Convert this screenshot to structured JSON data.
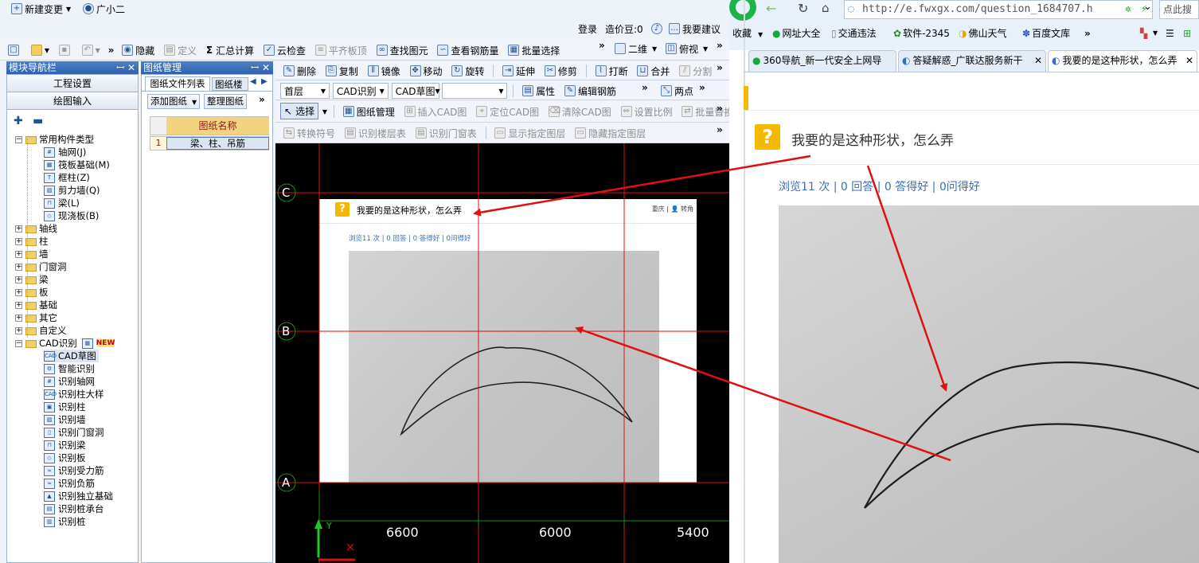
{
  "cad": {
    "menu": {
      "new_change": "新建变更",
      "user": "广小二"
    },
    "login_bar": {
      "login": "登录",
      "price_beans": "造价豆:0",
      "suggest": "我要建议"
    },
    "toolbar1": {
      "hide": "隐藏",
      "define": "定义",
      "sum_calc": "汇总计算",
      "cloud_check": "云检查",
      "flush_top": "平齐板顶",
      "find_element": "查找图元",
      "view_rebar": "查看钢筋量",
      "batch_select": "批量选择",
      "view_mode": "二维",
      "view_dir": "俯视"
    },
    "nav_panel": {
      "title": "模块导航栏",
      "project_settings": "工程设置",
      "drawing_input": "绘图输入"
    },
    "tree": {
      "common": "常用构件类型",
      "common_items": [
        "轴网(J)",
        "筏板基础(M)",
        "框柱(Z)",
        "剪力墙(Q)",
        "梁(L)",
        "现浇板(B)"
      ],
      "groups": [
        "轴线",
        "柱",
        "墙",
        "门窗洞",
        "梁",
        "板",
        "基础",
        "其它",
        "自定义"
      ],
      "cad_group": "CAD识别",
      "new_badge": "NEW",
      "cad_items": [
        "CAD草图",
        "智能识别",
        "识别轴网",
        "识别柱大样",
        "识别柱",
        "识别墙",
        "识别门窗洞",
        "识别梁",
        "识别板",
        "识别受力筋",
        "识别负筋",
        "识别独立基础",
        "识别桩承台",
        "识别桩"
      ]
    },
    "drawing_panel": {
      "title": "图纸管理",
      "tab1": "图纸文件列表",
      "tab2": "图纸楼",
      "add_drawing": "添加图纸",
      "organize": "整理图纸",
      "col_header": "图纸名称",
      "row_num": "1",
      "row_name": "梁、柱、吊筋"
    },
    "toolbar2": {
      "delete": "删除",
      "copy": "复制",
      "mirror": "镜像",
      "move": "移动",
      "rotate": "旋转",
      "extend": "延伸",
      "trim": "修剪",
      "break": "打断",
      "merge": "合并",
      "split": "分割"
    },
    "toolbar3": {
      "floor": "首层",
      "cad_recog": "CAD识别",
      "cad_sketch": "CAD草图",
      "property": "属性",
      "edit_rebar": "编辑钢筋",
      "two_point": "两点"
    },
    "toolbar4": {
      "select": "选择",
      "drawing_mgmt": "图纸管理",
      "insert_cad": "插入CAD图",
      "locate_cad": "定位CAD图",
      "clear_cad": "清除CAD图",
      "set_scale": "设置比例",
      "batch_replace": "批量替换"
    },
    "toolbar5": {
      "convert_symbol": "转换符号",
      "recog_floor_table": "识别楼层表",
      "recog_door_table": "识别门窗表",
      "show_layer": "显示指定图层",
      "hide_layer": "隐藏指定图层"
    },
    "canvas": {
      "axis_labels": [
        "C",
        "B",
        "A"
      ],
      "dimensions": [
        "6600",
        "6000",
        "5400"
      ],
      "y_label": "Y",
      "x_label": "X",
      "embedded_question": "我要的是这种形状，怎么弄",
      "embedded_links": "重庆 | 👤 转角",
      "embedded_stats": "浏览11 次 | 0 回答 | 0 答得好 | 0问得好"
    }
  },
  "browser": {
    "search_hint": "点此搜",
    "address": "http://e.fwxgx.com/question_1684707.h",
    "favorites": [
      "收藏",
      "网址大全",
      "交通违法",
      "软件-2345",
      "佛山天气",
      "百度文库"
    ],
    "tabs": [
      "360导航_新一代安全上网导",
      "答疑解惑_广联达服务新干",
      "我要的是这种形状，怎么弄"
    ],
    "question": {
      "title": "我要的是这种形状，怎么弄",
      "stats": "浏览11 次 | 0 回答 | 0 答得好 | 0问得好"
    },
    "colors": {
      "accent": "#3b6fb6",
      "question_icon": "#f5b800",
      "arrow": "#e01010"
    }
  }
}
